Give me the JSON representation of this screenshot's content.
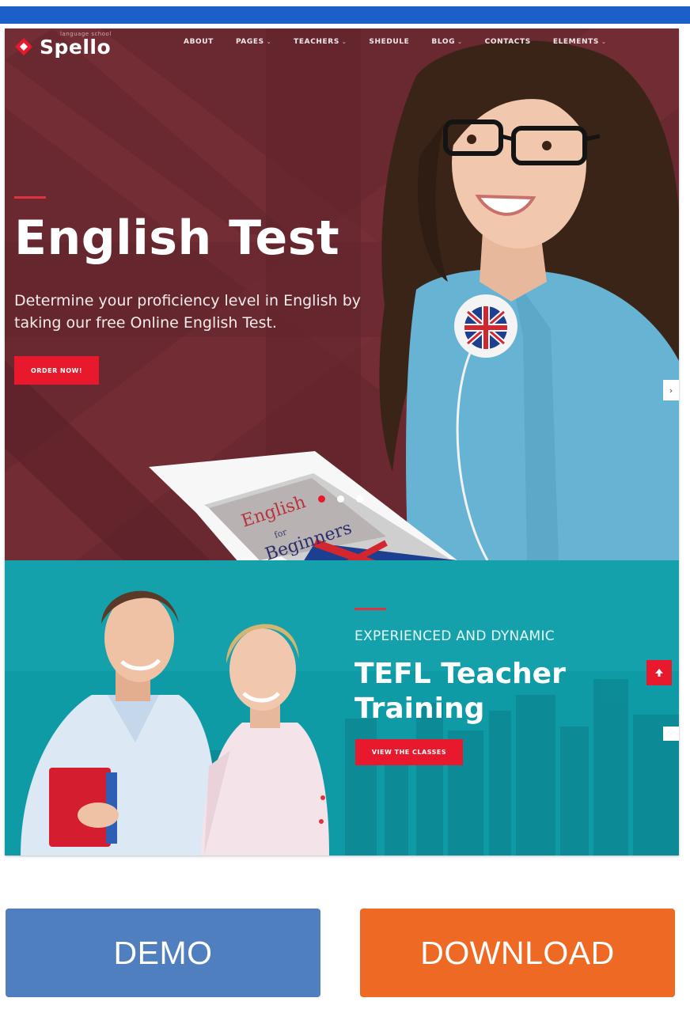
{
  "header": {
    "accent_color": "#1b5fc9"
  },
  "site": {
    "logo_text": "Spello",
    "logo_tagline": "language school",
    "nav": [
      {
        "label": "ABOUT",
        "has_dropdown": false
      },
      {
        "label": "PAGES",
        "has_dropdown": true
      },
      {
        "label": "TEACHERS",
        "has_dropdown": true
      },
      {
        "label": "SHEDULE",
        "has_dropdown": false
      },
      {
        "label": "BLOG",
        "has_dropdown": true
      },
      {
        "label": "CONTACTS",
        "has_dropdown": false
      },
      {
        "label": "ELEMENTS",
        "has_dropdown": true
      }
    ],
    "dropdown_caret": "⌄"
  },
  "hero": {
    "title": "English Test",
    "subtitle": "Determine your proficiency level in English by taking our free Online English Test.",
    "button": "ORDER NOW!",
    "book_line1": "English",
    "book_line2": "for",
    "book_line3": "Beginners",
    "slider_dots": 3,
    "active_dot": 0
  },
  "tefl": {
    "kicker": "EXPERIENCED AND DYNAMIC",
    "title_line1": "TEFL Teacher",
    "title_line2": "Training",
    "button": "VIEW THE CLASSES",
    "scroll_top_icon": "arrow-up-icon"
  },
  "actions": {
    "demo": "DEMO",
    "download": "DOWNLOAD"
  },
  "colors": {
    "hero_bg": "#6e2a33",
    "teal_bg": "#0e9aa5",
    "brand_red": "#e8192c",
    "demo_blue": "#4f7fbe",
    "download_orange": "#ee6a24"
  }
}
